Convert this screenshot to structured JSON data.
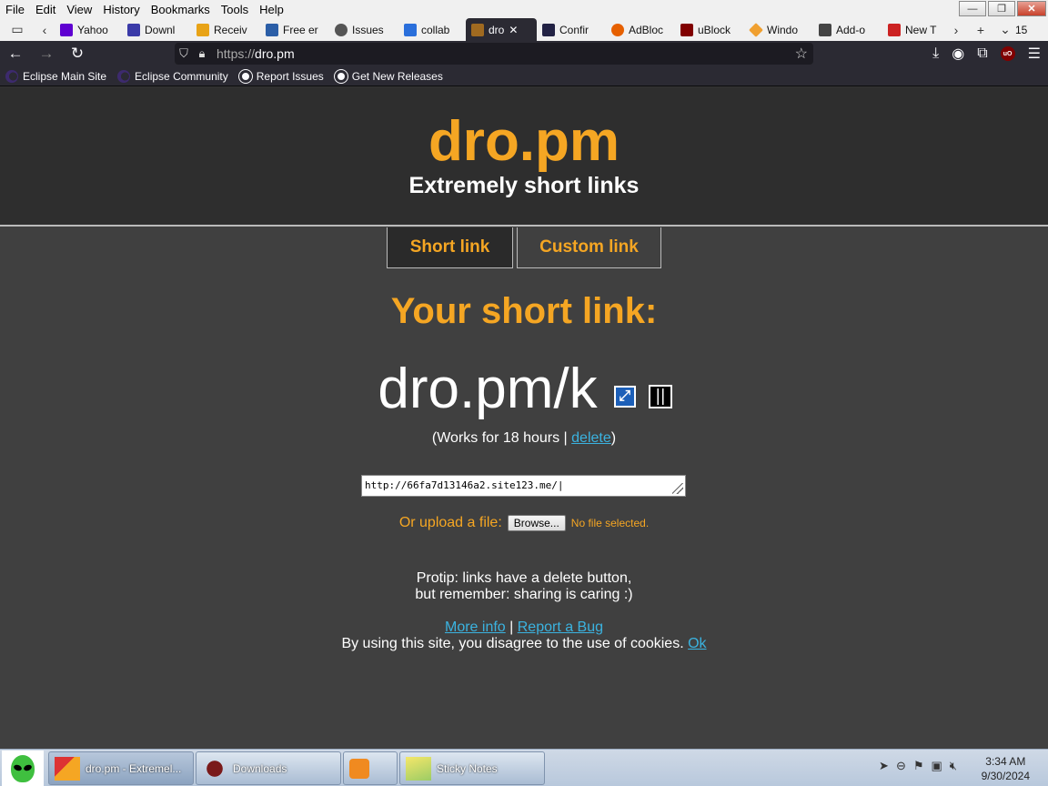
{
  "menu": [
    "File",
    "Edit",
    "View",
    "History",
    "Bookmarks",
    "Tools",
    "Help"
  ],
  "tabs": [
    {
      "label": "Yahoo",
      "color": "#5f01d1"
    },
    {
      "label": "Downl",
      "color": "#3a3aa8"
    },
    {
      "label": "Receiv",
      "color": "#e8a317"
    },
    {
      "label": "Free er",
      "color": "#2b5ea7"
    },
    {
      "label": "Issues",
      "color": "#555555"
    },
    {
      "label": "collab",
      "color": "#2a6fdb"
    },
    {
      "label": "dro",
      "color": "#a06a20"
    },
    {
      "label": "Confir",
      "color": "#222244"
    },
    {
      "label": "AdBloc",
      "color": "#e66000"
    },
    {
      "label": "uBlock",
      "color": "#800000"
    },
    {
      "label": "Windo",
      "color": "#f0a030"
    },
    {
      "label": "Add-o",
      "color": "#444444"
    },
    {
      "label": "New T",
      "color": "#cc2222"
    }
  ],
  "tab_count": "15",
  "url": {
    "prefix": "https://",
    "host": "dro.pm"
  },
  "bookmarks": [
    "Eclipse Main Site",
    "Eclipse Community",
    "Report Issues",
    "Get New Releases"
  ],
  "site": {
    "logo": "dro.pm",
    "tagline": "Extremely short links",
    "tab_short": "Short link",
    "tab_custom": "Custom link",
    "your_link": "Your short link:",
    "short_url": "dro.pm/k",
    "works_prefix": "(Works for 18 hours | ",
    "delete": "delete",
    "works_suffix": ")",
    "input_value": "http://66fa7d13146a2.site123.me/",
    "upload_label": "Or upload a file:",
    "browse": "Browse...",
    "no_file": "No file selected.",
    "protip_1": "Protip: links have a delete button,",
    "protip_2": "but remember: sharing is caring :)",
    "more_info": "More info",
    "sep": " | ",
    "report_bug": "Report a Bug",
    "cookie_text": "By using this site, you disagree to the use of cookies. ",
    "ok": "Ok"
  },
  "taskbar": {
    "items": [
      "dro.pm - Extremel...",
      "Downloads",
      "",
      "Sticky Notes"
    ],
    "time": "3:34 AM",
    "date": "9/30/2024"
  },
  "colors": {
    "accent": "#f5a623",
    "link": "#3bb3e0"
  }
}
